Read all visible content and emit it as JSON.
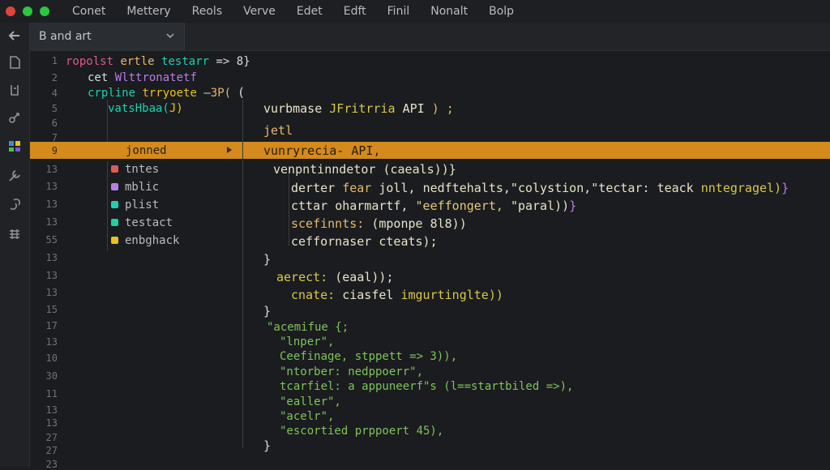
{
  "colors": {
    "close": "#e0443e",
    "minimize": "#2bc840",
    "maximize": "#2bc840",
    "highlight": "#d48a1c",
    "keyword": "#d8c84a",
    "func": "#e8b86a",
    "string": "#7fc45a",
    "punct": "#d9dde0",
    "purple": "#b57ee8",
    "teal": "#1fd0b0",
    "pink": "#e05a8a"
  },
  "menu": [
    "Conet",
    "Mettery",
    "Reols",
    "Verve",
    "Edet",
    "Edft",
    "Finil",
    "Nonalt",
    "Bolp"
  ],
  "tab": {
    "label": "B and art"
  },
  "activity_icons": [
    "file-icon",
    "search-icon",
    "source-control-icon",
    "extensions-icon",
    "tools-icon",
    "debug-icon",
    "grid-icon"
  ],
  "line_numbers": [
    "1",
    "2",
    "4",
    "5",
    "6",
    "7",
    "9",
    "13",
    "13",
    "13",
    "13",
    "55",
    "13",
    "13",
    "13",
    "15",
    "17",
    "13",
    "10",
    "30",
    "11",
    "13",
    "13",
    "27",
    "27",
    "23"
  ],
  "outline": {
    "l1": {
      "a": "ropolst",
      "b": "ertle",
      "c": "testarr",
      "d": "=>",
      "e": "8}"
    },
    "l2": {
      "a": "cet",
      "b": "Wlttronatetf"
    },
    "l3": {
      "a": "crpline",
      "b": "trryoete",
      "c": "–",
      "d": "3P("
    },
    "l4": {
      "a": "vatsHbaa(",
      "b": "J)"
    },
    "highlight_label": "jonned",
    "items": [
      {
        "label": "tntes",
        "color": "#e05a5a"
      },
      {
        "label": "mblic",
        "color": "#b57ee8"
      },
      {
        "label": "plist",
        "color": "#1fd0b0"
      },
      {
        "label": "testact",
        "color": "#1fd0a0"
      },
      {
        "label": "enbghack",
        "color": "#e8c21a"
      }
    ]
  },
  "code": {
    "brace_open": "(",
    "l1": {
      "a": "vurbmase",
      "b": "JFritrria",
      "c": "API",
      "d": ") ;"
    },
    "l2": "jetl",
    "l3": {
      "a": "vunryrecia-",
      "b": "API,"
    },
    "l4": {
      "a": "venpntinndetor",
      "b": "(caeals))}"
    },
    "l5": {
      "a": "derter",
      "b": "fear",
      "c": "joll,",
      "d": "nedftehalts,\"colystion,\"tectar:",
      "e": "teack",
      "f": "nntegragel)",
      "g": "}"
    },
    "l6": {
      "a": "cttar",
      "b": "oharmartf,",
      "c": "\"eeffongert,",
      "d": "\"paral))",
      "e": "}"
    },
    "l7": {
      "a": "scefinnts:",
      "b": "(mponpe",
      "c": "8l8))"
    },
    "l8": {
      "a": "ceffornaser",
      "b": "cteats);"
    },
    "close1": "}",
    "l9": {
      "a": "aerect:",
      "b": "(eaal));"
    },
    "l10": {
      "a": "cnate:",
      "b": "ciasfel",
      "c": "imgurtinglte))"
    },
    "close2": "}",
    "s1": "\"acemifue {;",
    "s2": "\"lnper\",",
    "s3": "Ceefinage, stppett => 3)),",
    "s4": "\"ntorber: nedppoerr\",",
    "s5": "tcarfiel: a appuneerf\"s (l==startbiled =>),",
    "s6": "\"ealler\",",
    "s7": "\"acelr\",",
    "s8": "\"escortied prppoert 45),",
    "close3": "}"
  }
}
